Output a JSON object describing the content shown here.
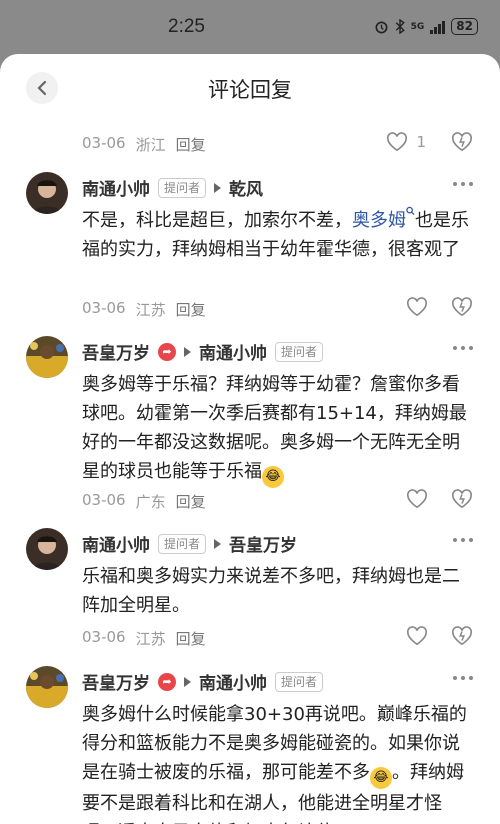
{
  "status": {
    "time": "2:25",
    "battery": "82",
    "network": "5G"
  },
  "header": {
    "title": "评论回复"
  },
  "top_meta": {
    "date": "03-06",
    "location": "浙江",
    "reply": "回复",
    "likes": "1"
  },
  "comments": [
    {
      "author": "南通小帅",
      "badge": "提问者",
      "reply_to": "乾风",
      "text_a": "不是，科比是超巨，加索尔不差，",
      "link": "奥多姆",
      "text_b": "也是乐福的实力，拜纳姆相当于幼年霍华德，很客观了",
      "date": "03-06",
      "location": "江苏",
      "reply": "回复"
    },
    {
      "author": "吾皇万岁",
      "badge": "提问者",
      "reply_to": "南通小帅",
      "text": "奥多姆等于乐福？拜纳姆等于幼霍？詹蜜你多看球吧。幼霍第一次季后赛都有15+14，拜纳姆最好的一年都没这数据呢。奥多姆一个无阵无全明星的球员也能等于乐福",
      "date": "03-06",
      "location": "广东",
      "reply": "回复"
    },
    {
      "author": "南通小帅",
      "badge": "提问者",
      "reply_to": "吾皇万岁",
      "text": "乐福和奥多姆实力来说差不多吧，拜纳姆也是二阵加全明星。",
      "date": "03-06",
      "location": "江苏",
      "reply": "回复"
    },
    {
      "author": "吾皇万岁",
      "badge": "提问者",
      "reply_to": "南通小帅",
      "text_a": "奥多姆什么时候能拿30+30再说吧。巅峰乐福的得分和篮板能力不是奥多姆能碰瓷的。如果你说是在骑士被废的乐福，那可能差不多",
      "text_b": "。拜纳姆要不是跟着科比和在湖人，他能进全明星才怪呢。透支自己身体和加索尔让位"
    }
  ],
  "colors": {
    "link": "#2d56a6",
    "meta": "#999999",
    "hot_badge": "#e8464a"
  }
}
